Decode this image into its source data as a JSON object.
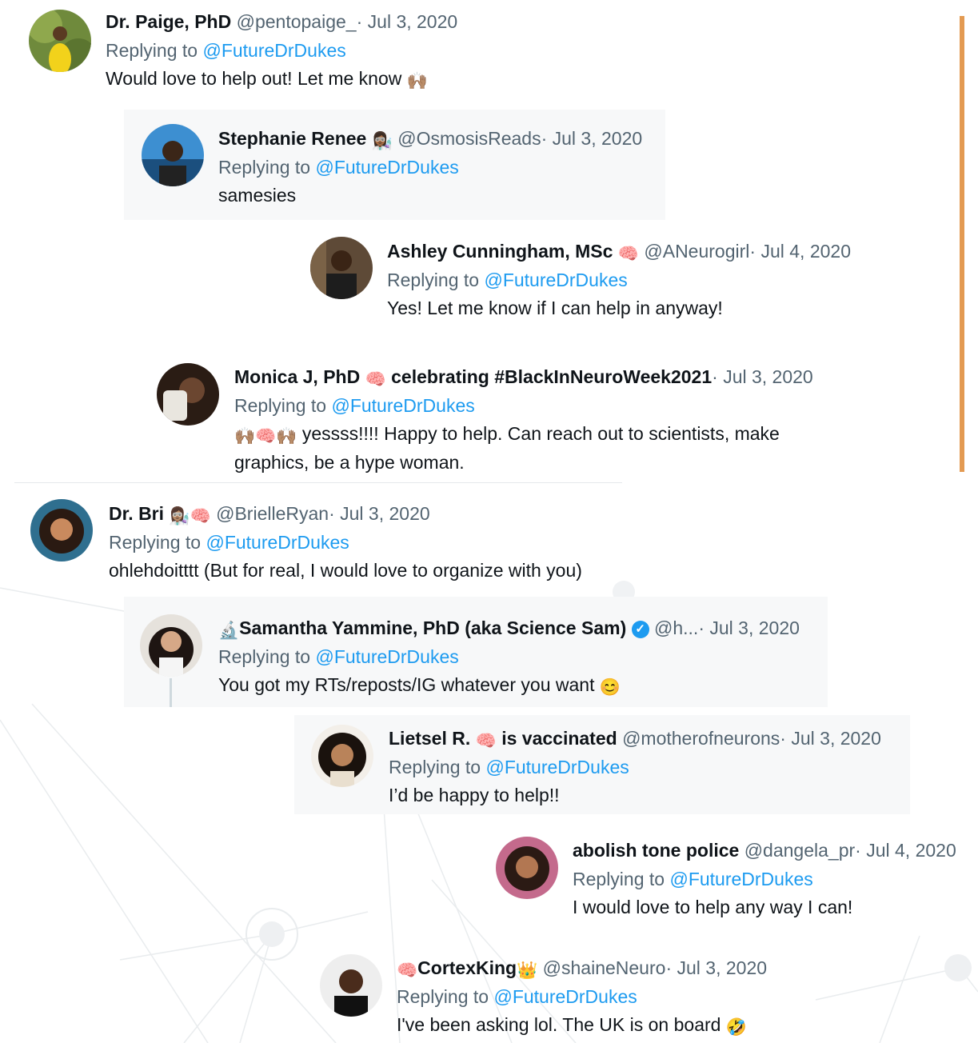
{
  "colors": {
    "accent_bar": "#e39a52",
    "link": "#1d9bf0",
    "muted": "#536471",
    "card": "#f7f8f9"
  },
  "replies": [
    {
      "name": "Dr. Paige, PhD",
      "handle": "@pentopaige_",
      "dot": "·",
      "date": "Jul 3, 2020",
      "replying_label": "Replying to",
      "mention": "@FutureDrDukes",
      "text": "Would love to help out! Let me know",
      "text_emoji": "🙌🏽"
    },
    {
      "name": "Stephanie Renee",
      "name_emoji": "👩🏾‍🔬",
      "handle": "@OsmosisReads",
      "dot": "·",
      "date": "Jul 3, 2020",
      "replying_label": "Replying to",
      "mention": "@FutureDrDukes",
      "text": "samesies"
    },
    {
      "name": "Ashley Cunningham, MSc",
      "name_emoji": "🧠",
      "handle": "@ANeurogirl",
      "dot": "·",
      "date": "Jul 4, 2020",
      "replying_label": "Replying to",
      "mention": "@FutureDrDukes",
      "text": "Yes! Let me know if I can help in anyway!"
    },
    {
      "name": "Monica J, PhD",
      "name_emoji": "🧠",
      "name_suffix": "celebrating #BlackInNeuroWeek2021",
      "dot": "·",
      "date": "Jul 3, 2020",
      "replying_label": "Replying to",
      "mention": "@FutureDrDukes",
      "text_emoji": "🙌🏽🧠🙌🏽",
      "text": "yessss!!!! Happy to help. Can reach out to scientists, make graphics, be a hype woman."
    },
    {
      "name": "Dr. Bri",
      "name_emoji": "👩🏽‍🔬🧠",
      "handle": "@BrielleRyan",
      "dot": "·",
      "date": "Jul 3, 2020",
      "replying_label": "Replying to",
      "mention": "@FutureDrDukes",
      "text": "ohlehdoitttt (But for real, I would love to organize with you)"
    },
    {
      "name_prefix_emoji": "🔬",
      "name": "Samantha Yammine, PhD (aka Science Sam)",
      "verified_icon": "✓",
      "handle": "@h...",
      "dot": "·",
      "date": "Jul 3, 2020",
      "replying_label": "Replying to",
      "mention": "@FutureDrDukes",
      "text": "You got my RTs/reposts/IG whatever you want",
      "text_emoji": "😊"
    },
    {
      "name": "Lietsel R.",
      "name_emoji": "🧠",
      "name_suffix": "is vaccinated",
      "handle": "@motherofneurons",
      "dot": "·",
      "date": "Jul 3, 2020",
      "replying_label": "Replying to",
      "mention": "@FutureDrDukes",
      "text": "I’d be happy to help!!"
    },
    {
      "name": "abolish tone police",
      "handle": "@dangela_pr",
      "dot": "·",
      "date": "Jul 4, 2020",
      "replying_label": "Replying to",
      "mention": "@FutureDrDukes",
      "text": "I would love to help any way I can!"
    },
    {
      "name_prefix_emoji": "🧠",
      "name": "CortexKing",
      "name_emoji": "👑",
      "handle": "@shaineNeuro",
      "dot": "·",
      "date": "Jul 3, 2020",
      "replying_label": "Replying to",
      "mention": "@FutureDrDukes",
      "text": "I've been asking lol. The UK is on board",
      "text_emoji": "🤣"
    }
  ]
}
